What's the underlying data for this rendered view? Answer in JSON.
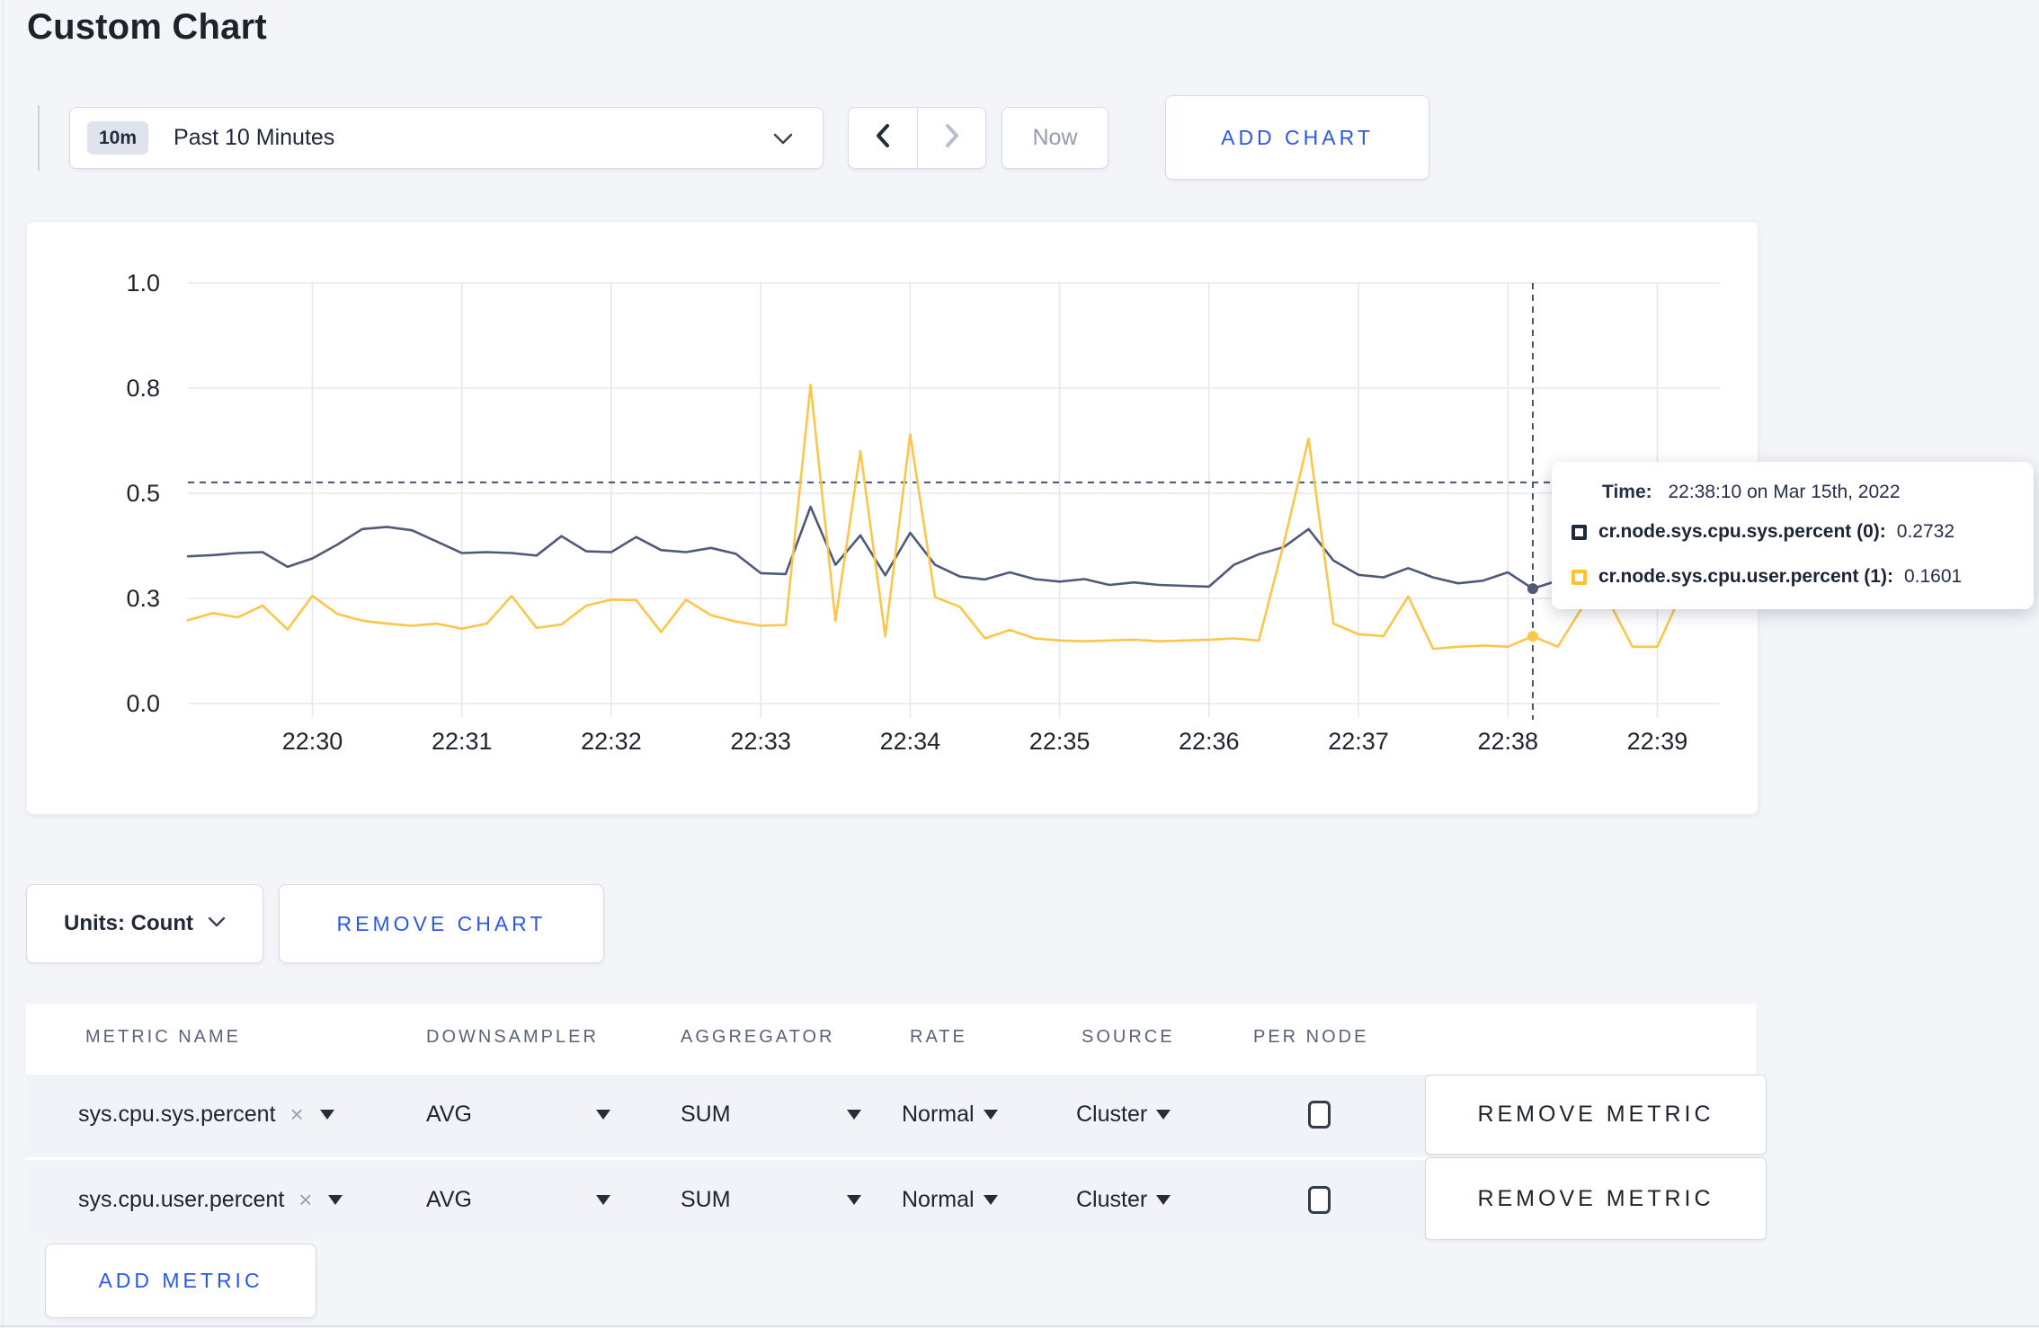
{
  "page": {
    "title": "Custom Chart",
    "background": "#f3f5f9"
  },
  "toolbar": {
    "time_range": {
      "badge": "10m",
      "label": "Past 10 Minutes",
      "dropdown_icon": "chevron-down-icon"
    },
    "prev_icon": "chevron-left-icon",
    "next_icon": "chevron-right-icon",
    "now_label": "Now",
    "add_chart_label": "ADD CHART"
  },
  "colors": {
    "series_sys": "#4e5a77",
    "series_user": "#fcc64b",
    "swatch_sys": "#1e2a3e",
    "swatch_user": "#ffc32e",
    "gridline": "#e7e8ec",
    "crosshair": "#44536e",
    "accent_blue": "#2a57ee"
  },
  "chart_data": {
    "type": "line",
    "title": "",
    "xlabel": "",
    "ylabel": "",
    "ylim": [
      0,
      1
    ],
    "grid": true,
    "legend_position": "tooltip-only",
    "x_ticks": [
      "22:30",
      "22:31",
      "22:32",
      "22:33",
      "22:34",
      "22:35",
      "22:36",
      "22:37",
      "22:38",
      "22:39"
    ],
    "y_ticks": [
      "0.0",
      "0.3",
      "0.5",
      "0.8",
      "1.0"
    ],
    "y_tick_values": [
      0,
      0.25,
      0.5,
      0.75,
      1.0
    ],
    "window_start": "22:29:10",
    "window_span_seconds": 605,
    "step_seconds": 10,
    "series": [
      {
        "name": "cr.node.sys.cpu.sys.percent (0)",
        "color": "#4e5a77",
        "values": [
          0.35,
          0.353,
          0.358,
          0.36,
          0.325,
          0.345,
          0.378,
          0.415,
          0.42,
          0.412,
          0.385,
          0.358,
          0.36,
          0.358,
          0.352,
          0.398,
          0.362,
          0.36,
          0.396,
          0.365,
          0.36,
          0.37,
          0.356,
          0.31,
          0.308,
          0.468,
          0.33,
          0.4,
          0.305,
          0.406,
          0.33,
          0.302,
          0.295,
          0.312,
          0.296,
          0.29,
          0.296,
          0.282,
          0.288,
          0.282,
          0.28,
          0.278,
          0.33,
          0.355,
          0.372,
          0.415,
          0.34,
          0.306,
          0.3,
          0.322,
          0.3,
          0.286,
          0.292,
          0.312,
          0.2732,
          0.292,
          0.3,
          0.31,
          0.3,
          0.296,
          0.304
        ]
      },
      {
        "name": "cr.node.sys.cpu.user.percent (1)",
        "color": "#fcc64b",
        "values": [
          0.198,
          0.215,
          0.205,
          0.233,
          0.176,
          0.256,
          0.213,
          0.197,
          0.19,
          0.185,
          0.19,
          0.178,
          0.19,
          0.256,
          0.18,
          0.188,
          0.233,
          0.247,
          0.246,
          0.17,
          0.247,
          0.21,
          0.195,
          0.185,
          0.187,
          0.758,
          0.197,
          0.6,
          0.16,
          0.64,
          0.253,
          0.23,
          0.155,
          0.175,
          0.155,
          0.15,
          0.148,
          0.15,
          0.152,
          0.148,
          0.15,
          0.152,
          0.155,
          0.15,
          0.38,
          0.63,
          0.19,
          0.165,
          0.16,
          0.255,
          0.13,
          0.135,
          0.138,
          0.135,
          0.1601,
          0.135,
          0.23,
          0.25,
          0.135,
          0.135,
          0.265
        ]
      }
    ],
    "crosshair": {
      "index": 54,
      "time": "22:38:10",
      "hline_value": 0.526
    }
  },
  "tooltip": {
    "time_label": "Time:",
    "time_value": "22:38:10 on Mar 15th, 2022",
    "rows": [
      {
        "name": "cr.node.sys.cpu.sys.percent (0):",
        "value": "0.2732",
        "swatch": "#1e2a3e"
      },
      {
        "name": "cr.node.sys.cpu.user.percent (1):",
        "value": "0.1601",
        "swatch": "#ffc32e"
      }
    ]
  },
  "units_bar": {
    "units_label": "Units: Count",
    "remove_chart_label": "REMOVE CHART"
  },
  "metrics_table": {
    "headers": [
      "METRIC NAME",
      "DOWNSAMPLER",
      "AGGREGATOR",
      "RATE",
      "SOURCE",
      "PER NODE"
    ],
    "rows": [
      {
        "metric": "sys.cpu.sys.percent",
        "close": "×",
        "downsampler": "AVG",
        "aggregator": "SUM",
        "rate": "Normal",
        "source": "Cluster",
        "per_node_checked": false,
        "remove_label": "REMOVE METRIC"
      },
      {
        "metric": "sys.cpu.user.percent",
        "close": "×",
        "downsampler": "AVG",
        "aggregator": "SUM",
        "rate": "Normal",
        "source": "Cluster",
        "per_node_checked": false,
        "remove_label": "REMOVE METRIC"
      }
    ],
    "add_metric_label": "ADD METRIC"
  }
}
